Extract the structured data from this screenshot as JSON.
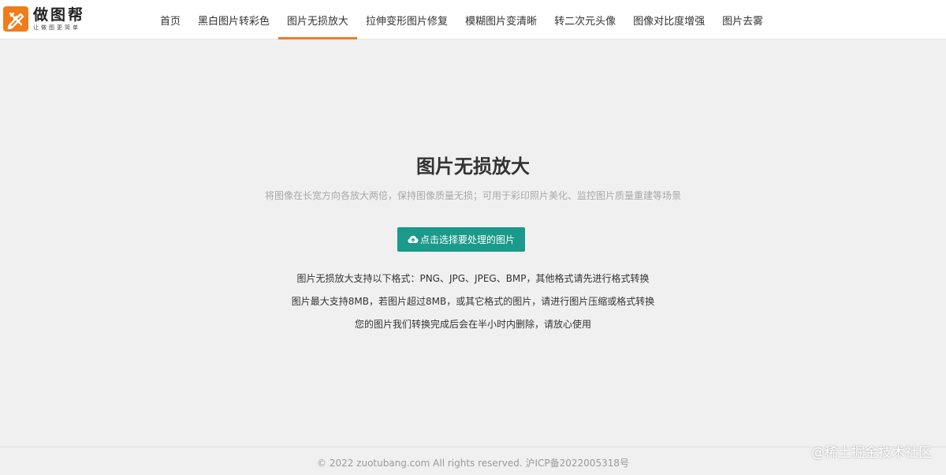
{
  "brand": {
    "title": "做图帮",
    "slogan": "让做图更简单",
    "accent_color": "#f07c1c",
    "logo_icon": "pencil-ruler-icon"
  },
  "nav": {
    "items": [
      {
        "label": "首页",
        "active": false
      },
      {
        "label": "黑白图片转彩色",
        "active": false
      },
      {
        "label": "图片无损放大",
        "active": true
      },
      {
        "label": "拉伸变形图片修复",
        "active": false
      },
      {
        "label": "模糊图片变清晰",
        "active": false
      },
      {
        "label": "转二次元头像",
        "active": false
      },
      {
        "label": "图像对比度增强",
        "active": false
      },
      {
        "label": "图片去雾",
        "active": false
      }
    ]
  },
  "hero": {
    "title": "图片无损放大",
    "subtitle": "将图像在长宽方向各放大两倍，保持图像质量无损；可用于彩印照片美化、监控图片质量重建等场景"
  },
  "upload": {
    "label": "点击选择要处理的图片",
    "icon": "cloud-upload-icon",
    "color": "#1a9a8a"
  },
  "info": {
    "line1": "图片无损放大支持以下格式：PNG、JPG、JPEG、BMP，其他格式请先进行格式转换",
    "line2": "图片最大支持8MB，若图片超过8MB，或其它格式的图片，请进行图片压缩或格式转换",
    "line3": "您的图片我们转换完成后会在半小时内删除，请放心使用"
  },
  "footer": {
    "copyright": "© 2022 zuotubang.com All rights reserved. 沪ICP备2022005318号"
  },
  "watermark": {
    "text": "@稀土掘金技术社区"
  }
}
